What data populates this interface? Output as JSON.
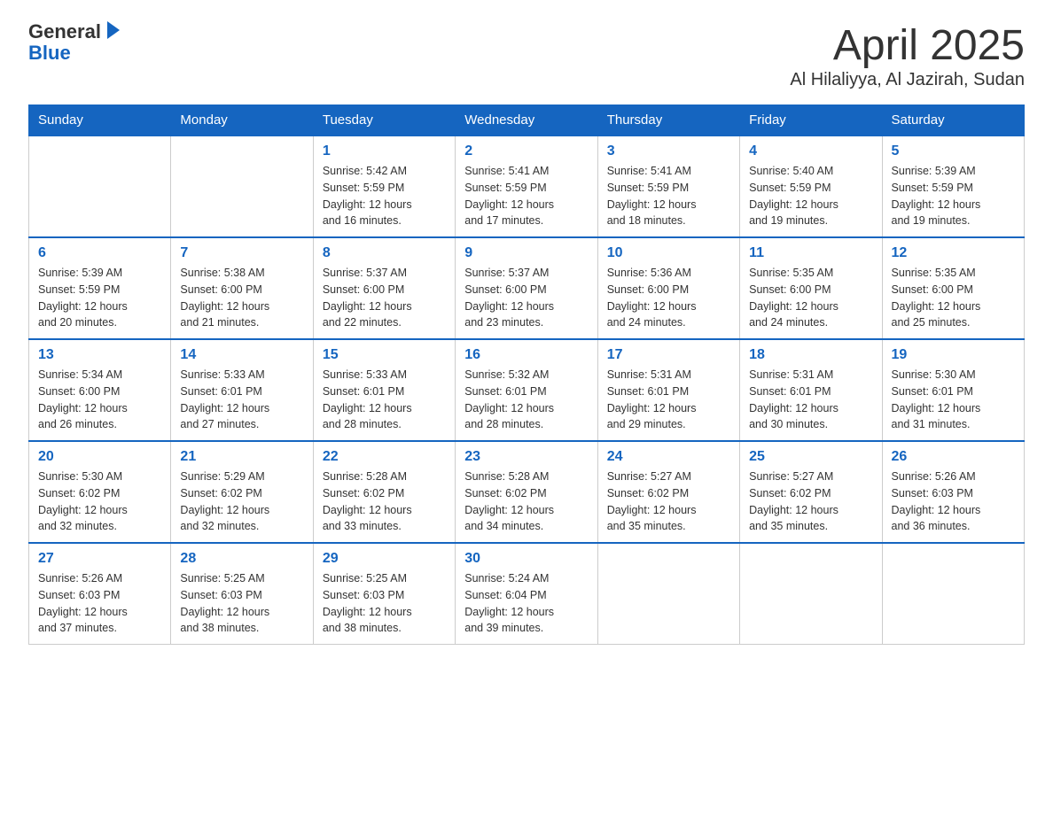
{
  "header": {
    "logo_general": "General",
    "logo_blue": "Blue",
    "title": "April 2025",
    "subtitle": "Al Hilaliyya, Al Jazirah, Sudan"
  },
  "days_of_week": [
    "Sunday",
    "Monday",
    "Tuesday",
    "Wednesday",
    "Thursday",
    "Friday",
    "Saturday"
  ],
  "weeks": [
    [
      {
        "day": "",
        "info": ""
      },
      {
        "day": "",
        "info": ""
      },
      {
        "day": "1",
        "info": "Sunrise: 5:42 AM\nSunset: 5:59 PM\nDaylight: 12 hours\nand 16 minutes."
      },
      {
        "day": "2",
        "info": "Sunrise: 5:41 AM\nSunset: 5:59 PM\nDaylight: 12 hours\nand 17 minutes."
      },
      {
        "day": "3",
        "info": "Sunrise: 5:41 AM\nSunset: 5:59 PM\nDaylight: 12 hours\nand 18 minutes."
      },
      {
        "day": "4",
        "info": "Sunrise: 5:40 AM\nSunset: 5:59 PM\nDaylight: 12 hours\nand 19 minutes."
      },
      {
        "day": "5",
        "info": "Sunrise: 5:39 AM\nSunset: 5:59 PM\nDaylight: 12 hours\nand 19 minutes."
      }
    ],
    [
      {
        "day": "6",
        "info": "Sunrise: 5:39 AM\nSunset: 5:59 PM\nDaylight: 12 hours\nand 20 minutes."
      },
      {
        "day": "7",
        "info": "Sunrise: 5:38 AM\nSunset: 6:00 PM\nDaylight: 12 hours\nand 21 minutes."
      },
      {
        "day": "8",
        "info": "Sunrise: 5:37 AM\nSunset: 6:00 PM\nDaylight: 12 hours\nand 22 minutes."
      },
      {
        "day": "9",
        "info": "Sunrise: 5:37 AM\nSunset: 6:00 PM\nDaylight: 12 hours\nand 23 minutes."
      },
      {
        "day": "10",
        "info": "Sunrise: 5:36 AM\nSunset: 6:00 PM\nDaylight: 12 hours\nand 24 minutes."
      },
      {
        "day": "11",
        "info": "Sunrise: 5:35 AM\nSunset: 6:00 PM\nDaylight: 12 hours\nand 24 minutes."
      },
      {
        "day": "12",
        "info": "Sunrise: 5:35 AM\nSunset: 6:00 PM\nDaylight: 12 hours\nand 25 minutes."
      }
    ],
    [
      {
        "day": "13",
        "info": "Sunrise: 5:34 AM\nSunset: 6:00 PM\nDaylight: 12 hours\nand 26 minutes."
      },
      {
        "day": "14",
        "info": "Sunrise: 5:33 AM\nSunset: 6:01 PM\nDaylight: 12 hours\nand 27 minutes."
      },
      {
        "day": "15",
        "info": "Sunrise: 5:33 AM\nSunset: 6:01 PM\nDaylight: 12 hours\nand 28 minutes."
      },
      {
        "day": "16",
        "info": "Sunrise: 5:32 AM\nSunset: 6:01 PM\nDaylight: 12 hours\nand 28 minutes."
      },
      {
        "day": "17",
        "info": "Sunrise: 5:31 AM\nSunset: 6:01 PM\nDaylight: 12 hours\nand 29 minutes."
      },
      {
        "day": "18",
        "info": "Sunrise: 5:31 AM\nSunset: 6:01 PM\nDaylight: 12 hours\nand 30 minutes."
      },
      {
        "day": "19",
        "info": "Sunrise: 5:30 AM\nSunset: 6:01 PM\nDaylight: 12 hours\nand 31 minutes."
      }
    ],
    [
      {
        "day": "20",
        "info": "Sunrise: 5:30 AM\nSunset: 6:02 PM\nDaylight: 12 hours\nand 32 minutes."
      },
      {
        "day": "21",
        "info": "Sunrise: 5:29 AM\nSunset: 6:02 PM\nDaylight: 12 hours\nand 32 minutes."
      },
      {
        "day": "22",
        "info": "Sunrise: 5:28 AM\nSunset: 6:02 PM\nDaylight: 12 hours\nand 33 minutes."
      },
      {
        "day": "23",
        "info": "Sunrise: 5:28 AM\nSunset: 6:02 PM\nDaylight: 12 hours\nand 34 minutes."
      },
      {
        "day": "24",
        "info": "Sunrise: 5:27 AM\nSunset: 6:02 PM\nDaylight: 12 hours\nand 35 minutes."
      },
      {
        "day": "25",
        "info": "Sunrise: 5:27 AM\nSunset: 6:02 PM\nDaylight: 12 hours\nand 35 minutes."
      },
      {
        "day": "26",
        "info": "Sunrise: 5:26 AM\nSunset: 6:03 PM\nDaylight: 12 hours\nand 36 minutes."
      }
    ],
    [
      {
        "day": "27",
        "info": "Sunrise: 5:26 AM\nSunset: 6:03 PM\nDaylight: 12 hours\nand 37 minutes."
      },
      {
        "day": "28",
        "info": "Sunrise: 5:25 AM\nSunset: 6:03 PM\nDaylight: 12 hours\nand 38 minutes."
      },
      {
        "day": "29",
        "info": "Sunrise: 5:25 AM\nSunset: 6:03 PM\nDaylight: 12 hours\nand 38 minutes."
      },
      {
        "day": "30",
        "info": "Sunrise: 5:24 AM\nSunset: 6:04 PM\nDaylight: 12 hours\nand 39 minutes."
      },
      {
        "day": "",
        "info": ""
      },
      {
        "day": "",
        "info": ""
      },
      {
        "day": "",
        "info": ""
      }
    ]
  ]
}
